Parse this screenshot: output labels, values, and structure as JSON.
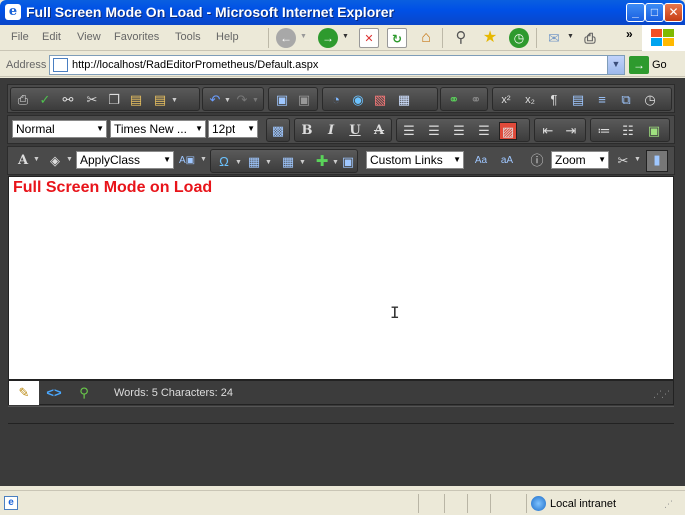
{
  "window": {
    "title": "Full Screen Mode On Load - Microsoft Internet Explorer",
    "minimize_glyph": "_",
    "maximize_glyph": "□",
    "close_glyph": "✕"
  },
  "menu": {
    "items": [
      "File",
      "Edit",
      "View",
      "Favorites",
      "Tools",
      "Help"
    ],
    "chevron": "»"
  },
  "address": {
    "label": "Address",
    "url": "http://localhost/RadEditorPrometheus/Default.aspx",
    "go_label": "Go"
  },
  "editor": {
    "paragraph_style": "Normal",
    "font_name": "Times New ...",
    "font_size": "12pt",
    "css_class": "ApplyClass",
    "custom_links": "Custom Links",
    "zoom": "Zoom",
    "content_heading": "Full Screen Mode on Load",
    "word_count": "Words: 5 Characters: 24",
    "resize_grip": "⋰⋰"
  },
  "status": {
    "zone": "Local intranet"
  },
  "colors": {
    "heading_red": "#E8141A",
    "editor_dark": "#3A3A3A",
    "xp_blue": "#0A5FE0"
  }
}
